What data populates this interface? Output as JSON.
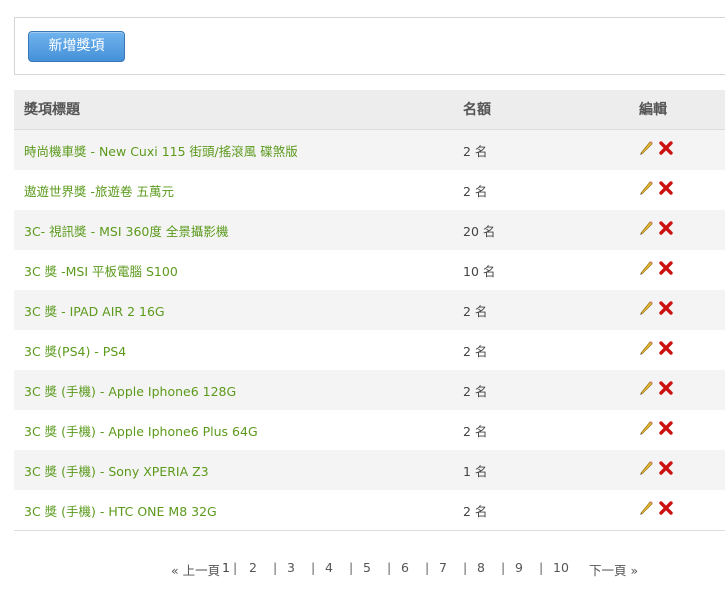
{
  "toolbar": {
    "add_label": "新增獎項"
  },
  "table": {
    "headers": {
      "title": "獎項標題",
      "count": "名額",
      "edit": "編輯"
    },
    "rows": [
      {
        "title": "時尚機車獎 - New Cuxi 115 街頭/搖滾風 碟煞版",
        "count": "2 名"
      },
      {
        "title": "遨遊世界獎 -旅遊卷 五萬元",
        "count": "2 名"
      },
      {
        "title": "3C- 視訊獎 - MSI 360度 全景攝影機",
        "count": "20 名"
      },
      {
        "title": "3C 獎 -MSI 平板電腦 S100",
        "count": "10 名"
      },
      {
        "title": "3C 獎 - IPAD AIR 2 16G",
        "count": "2 名"
      },
      {
        "title": "3C 獎(PS4) - PS4",
        "count": "2 名"
      },
      {
        "title": "3C 獎 (手機) - Apple Iphone6 128G",
        "count": "2 名"
      },
      {
        "title": "3C 獎 (手機) - Apple Iphone6 Plus 64G",
        "count": "2 名"
      },
      {
        "title": "3C 獎 (手機) - Sony XPERIA Z3",
        "count": "1 名"
      },
      {
        "title": "3C 獎 (手機) - HTC ONE M8 32G",
        "count": "2 名"
      }
    ],
    "icons": {
      "edit": "pencil-icon",
      "delete": "delete-x-icon"
    }
  },
  "pagination": {
    "prev_label": "« 上一頁",
    "current": "1",
    "pages": [
      "2",
      "3",
      "4",
      "5",
      "6",
      "7",
      "8",
      "9",
      "10"
    ],
    "next_label": "下一頁 »",
    "separator": "|"
  },
  "colors": {
    "link": "#5b9a1c",
    "button": "#4591d8",
    "delete": "#cc1111",
    "header_bg": "#ededed"
  }
}
